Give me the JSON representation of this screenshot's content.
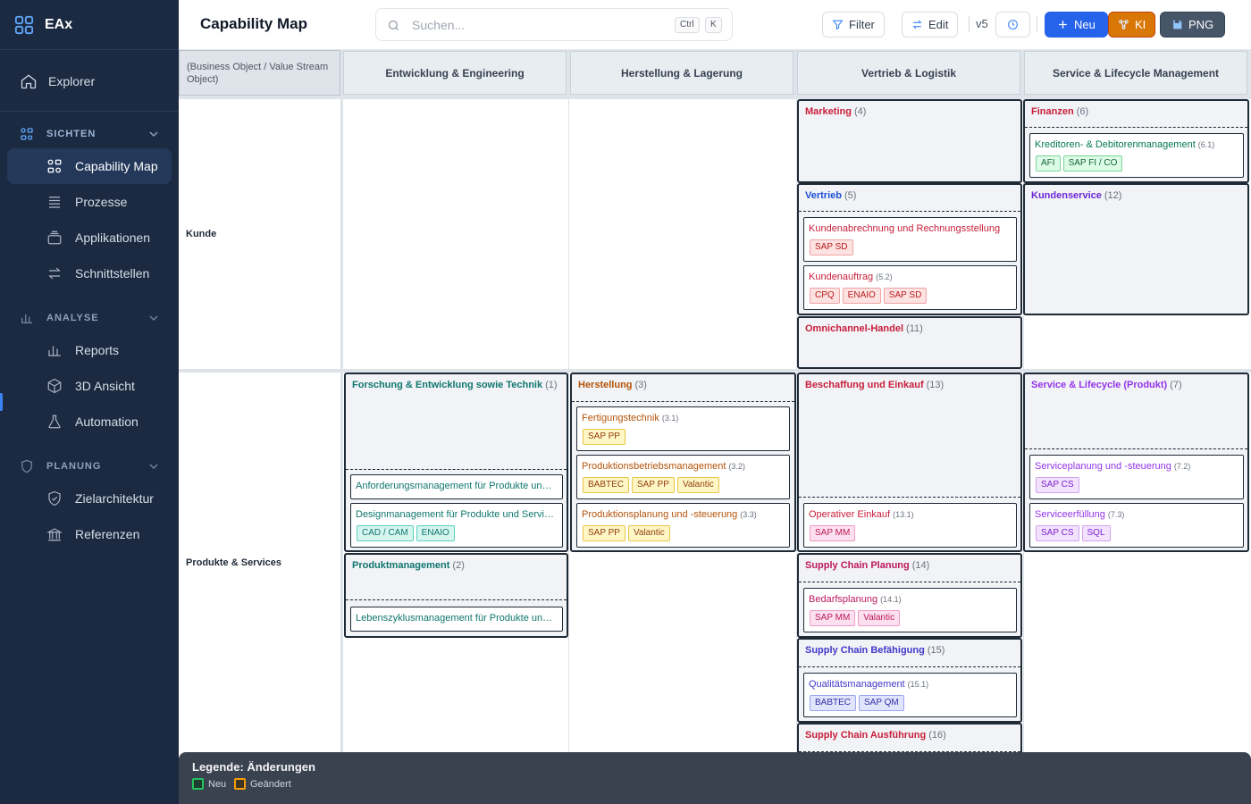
{
  "app": {
    "name": "EAx"
  },
  "sidebar": {
    "explorer": "Explorer",
    "sections": {
      "sichten": {
        "label": "SICHTEN",
        "items": [
          "Capability Map",
          "Prozesse",
          "Applikationen",
          "Schnittstellen"
        ]
      },
      "analyse": {
        "label": "ANALYSE",
        "items": [
          "Reports",
          "3D Ansicht",
          "Automation"
        ]
      },
      "planung": {
        "label": "PLANUNG",
        "items": [
          "Zielarchitektur",
          "Referenzen"
        ]
      }
    },
    "active_item": "Capability Map"
  },
  "topbar": {
    "title": "Capability Map",
    "search_placeholder": "Suchen...",
    "kbd_ctrl": "Ctrl",
    "kbd_k": "K",
    "filter": "Filter",
    "edit": "Edit",
    "version": "v5",
    "neu": "Neu",
    "ki": "KI",
    "png": "PNG"
  },
  "map": {
    "corner": "(Business Object / Value Stream Object)",
    "columns": [
      "Entwicklung & Engineering",
      "Herstellung & Lagerung",
      "Vertrieb & Logistik",
      "Service & Lifecycle Management"
    ],
    "rows": [
      "Kunde",
      "Produkte & Services"
    ],
    "blocks": {
      "marketing": {
        "title": "Marketing",
        "count": "(4)",
        "color": "#c81e3a"
      },
      "finanzen": {
        "title": "Finanzen",
        "count": "(6)",
        "color": "#c81e3a",
        "items": [
          {
            "title": "Kreditoren- & Debitorenmanagement",
            "num": "(6.1)",
            "tags": [
              "AFI",
              "SAP FI / CO"
            ]
          }
        ]
      },
      "vertrieb": {
        "title": "Vertrieb",
        "count": "(5)",
        "color": "#1d4ed8",
        "items": [
          {
            "title": "Kundenabrechnung und Rechnungsstellung",
            "num": "",
            "tags": [
              "SAP SD"
            ]
          },
          {
            "title": "Kundenauftrag",
            "num": "(5.2)",
            "tags": [
              "CPQ",
              "ENAIO",
              "SAP SD"
            ]
          }
        ]
      },
      "kundenservice": {
        "title": "Kundenservice",
        "count": "(12)",
        "color": "#6d28d9"
      },
      "omnichannel": {
        "title": "Omnichannel-Handel",
        "count": "(11)",
        "color": "#c81e3a"
      },
      "forschung": {
        "title": "Forschung & Entwicklung sowie Technik",
        "count": "(1)",
        "color": "#0f766e",
        "items": [
          {
            "title": "Anforderungsmanagement für Produkte und Services",
            "num": "",
            "tags": []
          },
          {
            "title": "Designmanagement für Produkte und Services",
            "num": "",
            "tags": [
              "CAD / CAM",
              "ENAIO"
            ]
          }
        ]
      },
      "herstellung": {
        "title": "Herstellung",
        "count": "(3)",
        "color": "#b45309",
        "items": [
          {
            "title": "Fertigungstechnik",
            "num": "(3.1)",
            "tags": [
              "SAP PP"
            ]
          },
          {
            "title": "Produktionsbetriebsmanagement",
            "num": "(3.2)",
            "tags": [
              "BABTEC",
              "SAP PP",
              "Valantic"
            ]
          },
          {
            "title": "Produktionsplanung und -steuerung",
            "num": "(3.3)",
            "tags": [
              "SAP PP",
              "Valantic"
            ]
          }
        ]
      },
      "beschaffung": {
        "title": "Beschaffung und Einkauf",
        "count": "(13)",
        "color": "#c81e3a",
        "items": [
          {
            "title": "Operativer Einkauf",
            "num": "(13.1)",
            "tags": [
              "SAP MM"
            ]
          }
        ]
      },
      "servicelc": {
        "title": "Service & Lifecycle (Produkt)",
        "count": "(7)",
        "color": "#9333ea",
        "items": [
          {
            "title": "Serviceplanung und -steuerung",
            "num": "(7.2)",
            "tags": [
              "SAP CS"
            ]
          },
          {
            "title": "Serviceerfüllung",
            "num": "(7.3)",
            "tags": [
              "SAP CS",
              "SQL"
            ]
          }
        ]
      },
      "produktmanagement": {
        "title": "Produktmanagement",
        "count": "(2)",
        "color": "#0f766e",
        "items": [
          {
            "title": "Lebenszyklusmanagement für Produkte und Services",
            "num": "",
            "tags": []
          }
        ]
      },
      "scplanung": {
        "title": "Supply Chain Planung",
        "count": "(14)",
        "color": "#be185d",
        "items": [
          {
            "title": "Bedarfsplanung",
            "num": "(14.1)",
            "tags": [
              "SAP MM",
              "Valantic"
            ]
          }
        ]
      },
      "scbefaehigung": {
        "title": "Supply Chain Befähigung",
        "count": "(15)",
        "color": "#4338ca",
        "items": [
          {
            "title": "Qualitätsmanagement",
            "num": "(15.1)",
            "tags": [
              "BABTEC",
              "SAP QM"
            ]
          }
        ]
      },
      "scausfuehrung": {
        "title": "Supply Chain Ausführung",
        "count": "(16)",
        "color": "#c81e3a"
      }
    }
  },
  "legend": {
    "title": "Legende: Änderungen",
    "items": [
      {
        "label": "Neu",
        "color": "#22c55e"
      },
      {
        "label": "Geändert",
        "color": "#f59e0b"
      }
    ]
  }
}
